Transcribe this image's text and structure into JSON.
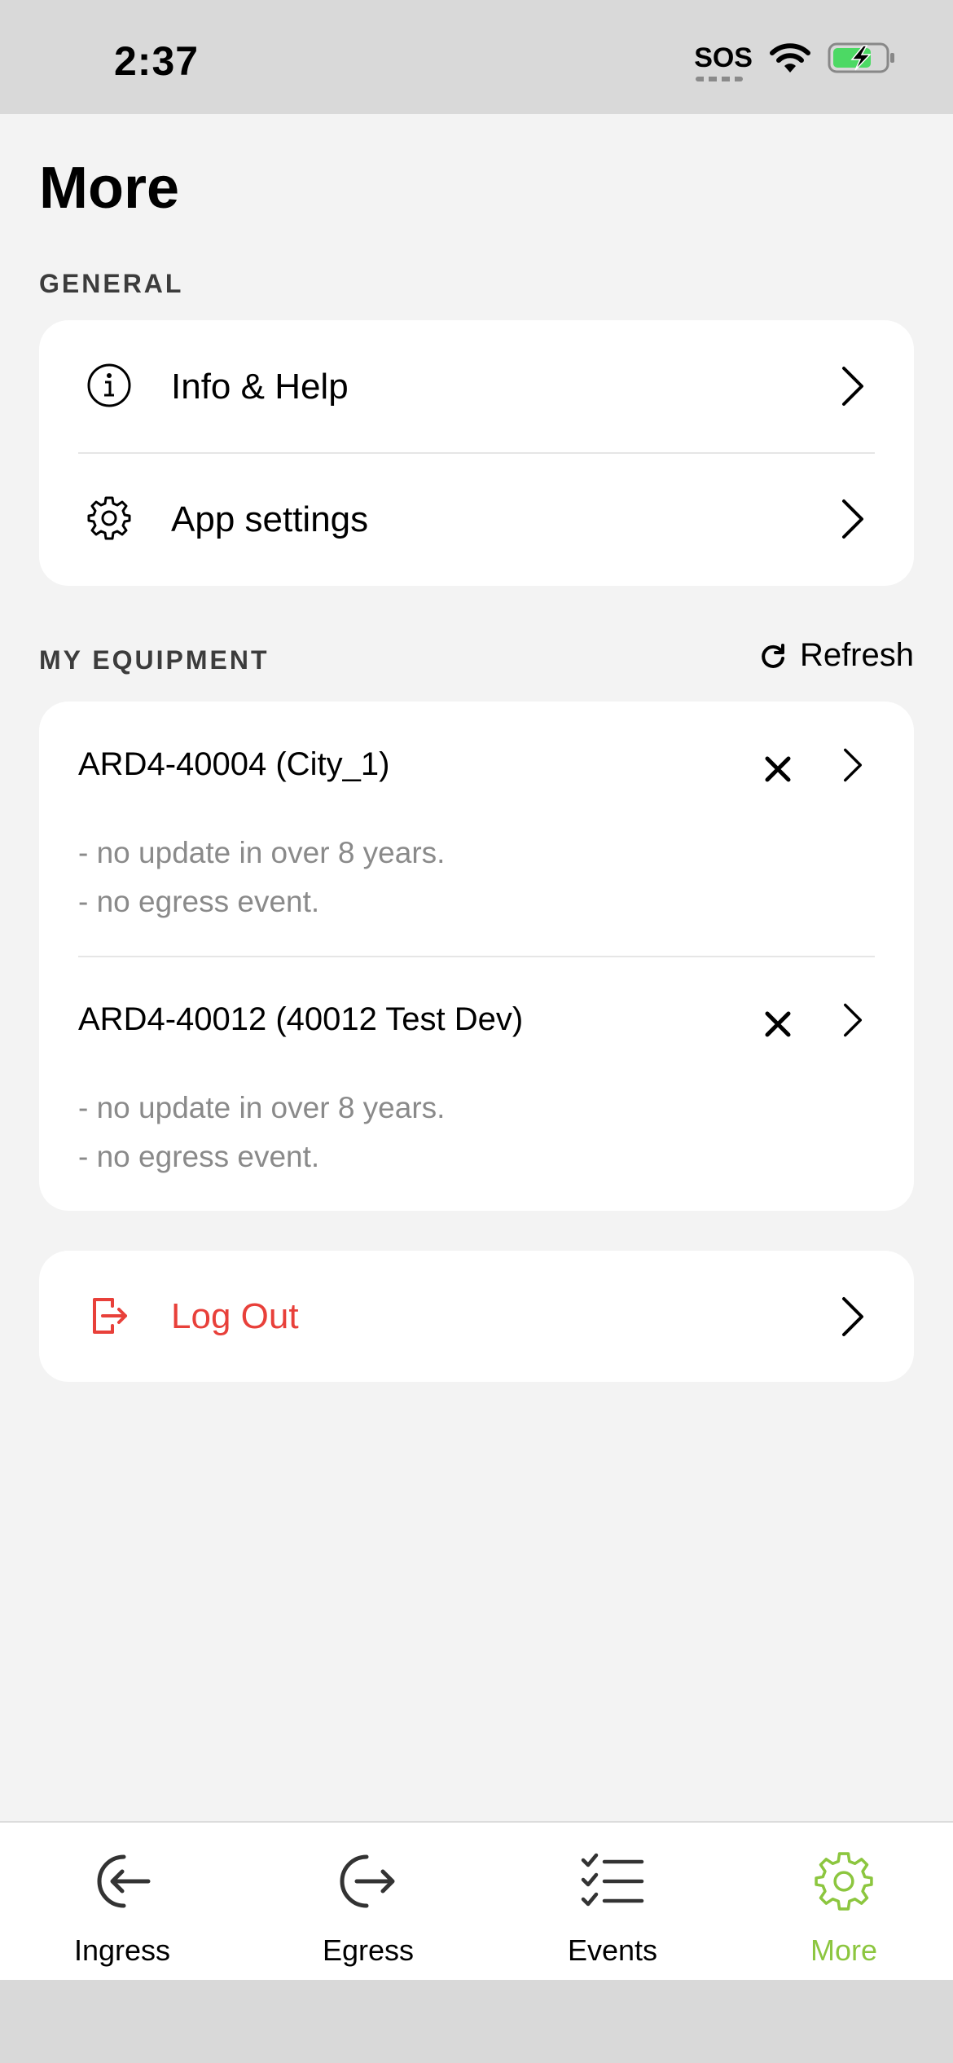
{
  "status_bar": {
    "time": "2:37",
    "sos": "SOS"
  },
  "page": {
    "title": "More"
  },
  "general": {
    "section_label": "GENERAL",
    "items": [
      {
        "label": "Info & Help",
        "icon": "info-icon"
      },
      {
        "label": "App settings",
        "icon": "gear-icon"
      }
    ]
  },
  "equipment": {
    "section_label": "MY EQUIPMENT",
    "refresh_label": "Refresh",
    "items": [
      {
        "title": "ARD4-40004 (City_1)",
        "note1": "- no update in over 8 years.",
        "note2": "- no egress event."
      },
      {
        "title": "ARD4-40012 (40012 Test Dev)",
        "note1": "- no update in over 8 years.",
        "note2": "- no egress event."
      }
    ]
  },
  "logout": {
    "label": "Log Out"
  },
  "tabbar": {
    "tabs": [
      {
        "label": "Ingress",
        "icon": "ingress-icon"
      },
      {
        "label": "Egress",
        "icon": "egress-icon"
      },
      {
        "label": "Events",
        "icon": "checklist-icon"
      },
      {
        "label": "More",
        "icon": "gear-icon"
      }
    ],
    "active_index": 3
  },
  "colors": {
    "accent": "#8cc63f",
    "danger": "#e8403a",
    "background": "#f3f3f3"
  }
}
